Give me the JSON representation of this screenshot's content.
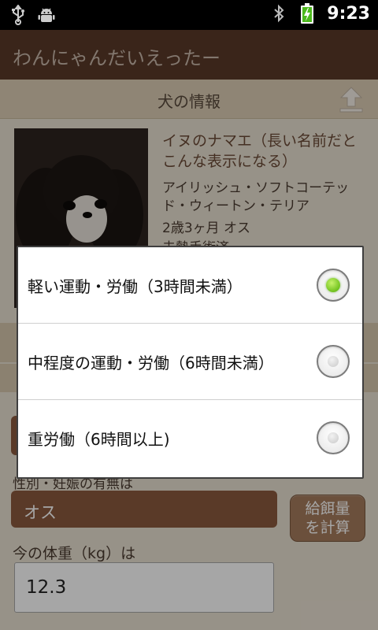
{
  "status_bar": {
    "time": "9:23",
    "left_icons": [
      "usb-icon",
      "android-debug-icon"
    ],
    "right_icons": [
      "bluetooth-icon",
      "battery-charging-icon"
    ]
  },
  "app": {
    "title": "わんにゃんだいえったー"
  },
  "section": {
    "title": "犬の情報",
    "action_icon": "upload-icon"
  },
  "dog": {
    "name": "イヌのナマエ（長い名前だとこんな表示になる）",
    "breed": "アイリッシュ・ソフトコーテッド・ウィートン・テリア",
    "age_sex": "2歳3ヶ月  オス",
    "neuter_status": "去勢手術済"
  },
  "form": {
    "sex_label": "性別・妊娠の有無は",
    "sex_value": "オス",
    "calc_button": "給餌量\nを計算",
    "weight_label": "今の体重（kg）は",
    "weight_value": "12.3"
  },
  "dialog": {
    "selected_index": 0,
    "options": [
      {
        "label": "軽い運動・労働（3時間未満）"
      },
      {
        "label": "中程度の運動・労働（6時間未満）"
      },
      {
        "label": "重労働（6時間以上)"
      }
    ]
  },
  "colors": {
    "title_bar": "#5a3a29",
    "section_header": "#dccdb4",
    "field_brown": "#8a5a3e",
    "radio_checked": "#71c21e"
  }
}
